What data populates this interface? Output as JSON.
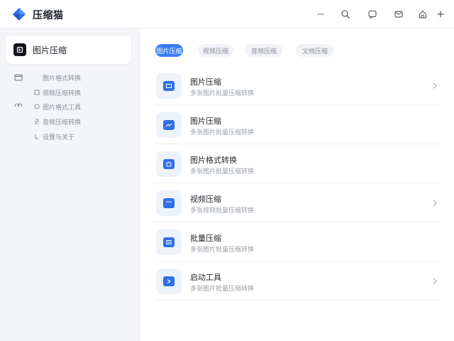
{
  "app": {
    "title": "压缩猫"
  },
  "titlebar": {
    "buttons": [
      {
        "name": "minimize-button",
        "icon": "minimize-icon"
      },
      {
        "name": "search-button",
        "icon": "search-icon"
      },
      {
        "name": "chat-button",
        "icon": "chat-icon"
      },
      {
        "name": "mail-button",
        "icon": "mail-icon"
      },
      {
        "name": "home-button",
        "icon": "home-icon"
      },
      {
        "name": "add-button",
        "icon": "plus-icon"
      }
    ]
  },
  "sidebar": {
    "active": {
      "label": "图片压缩",
      "icon": "image-icon"
    },
    "items": [
      {
        "label": "图片格式转换",
        "icon": "folder-icon"
      },
      {
        "label": "视频压缩转换",
        "icon": "square-icon"
      },
      {
        "label": "图片格式工具",
        "icon": "circle-icon"
      },
      {
        "label": "音频压缩转换",
        "icon": "audio-icon"
      },
      {
        "label": "设置与关于",
        "icon": "info-icon"
      }
    ]
  },
  "tabs": [
    {
      "label": "图片压缩",
      "active": true
    },
    {
      "label": "视频压缩",
      "active": false
    },
    {
      "label": "音频压缩",
      "active": false
    },
    {
      "label": "文档压缩",
      "active": false
    }
  ],
  "tools": [
    {
      "title": "图片压缩",
      "subtitle": "多张图片批量压缩转换",
      "chevron": true
    },
    {
      "title": "图片压缩",
      "subtitle": "多张图片批量压缩转换",
      "chevron": false
    },
    {
      "title": "图片格式转换",
      "subtitle": "多张图片批量压缩转换",
      "chevron": false
    },
    {
      "title": "视频压缩",
      "subtitle": "多张视频批量压缩转换",
      "chevron": true
    },
    {
      "title": "批量压缩",
      "subtitle": "多张图片批量压缩转换",
      "chevron": false
    },
    {
      "title": "启动工具",
      "subtitle": "多张图片批量压缩转换",
      "chevron": true
    }
  ],
  "colors": {
    "accent": "#3a7cf0",
    "tile_bg": "#eef2fb",
    "icon_fill": "#2f6fe8"
  }
}
